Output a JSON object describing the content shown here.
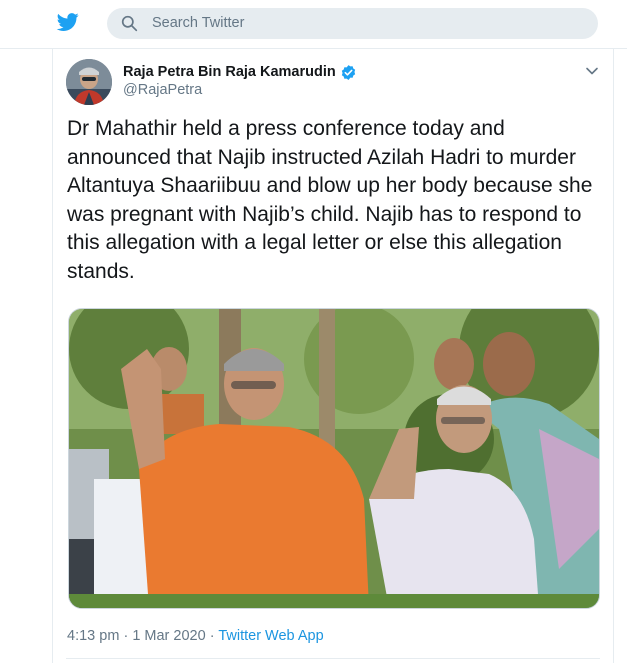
{
  "search": {
    "placeholder": "Search Twitter"
  },
  "tweet": {
    "author_name": "Raja Petra Bin Raja Kamarudin",
    "handle": "@RajaPetra",
    "verified": true,
    "text": "Dr Mahathir held a press conference today and announced that Najib instructed Azilah Hadri to murder Altantuya Shaariibuu and blow up her body because she was pregnant with Najib’s child. Najib has to respond to this allegation with a legal letter or else this allegation stands.",
    "time": "4:13 pm",
    "separator": "·",
    "date": "1 Mar 2020",
    "source_app": "Twitter Web App"
  },
  "colors": {
    "brand": "#1da1f2",
    "link": "#1b95e0",
    "muted": "#657786",
    "text": "#14171a",
    "search_bg": "#e6ecf0"
  },
  "icons": [
    "twitter-bird-icon",
    "search-icon",
    "verified-badge-icon",
    "chevron-down-icon"
  ]
}
